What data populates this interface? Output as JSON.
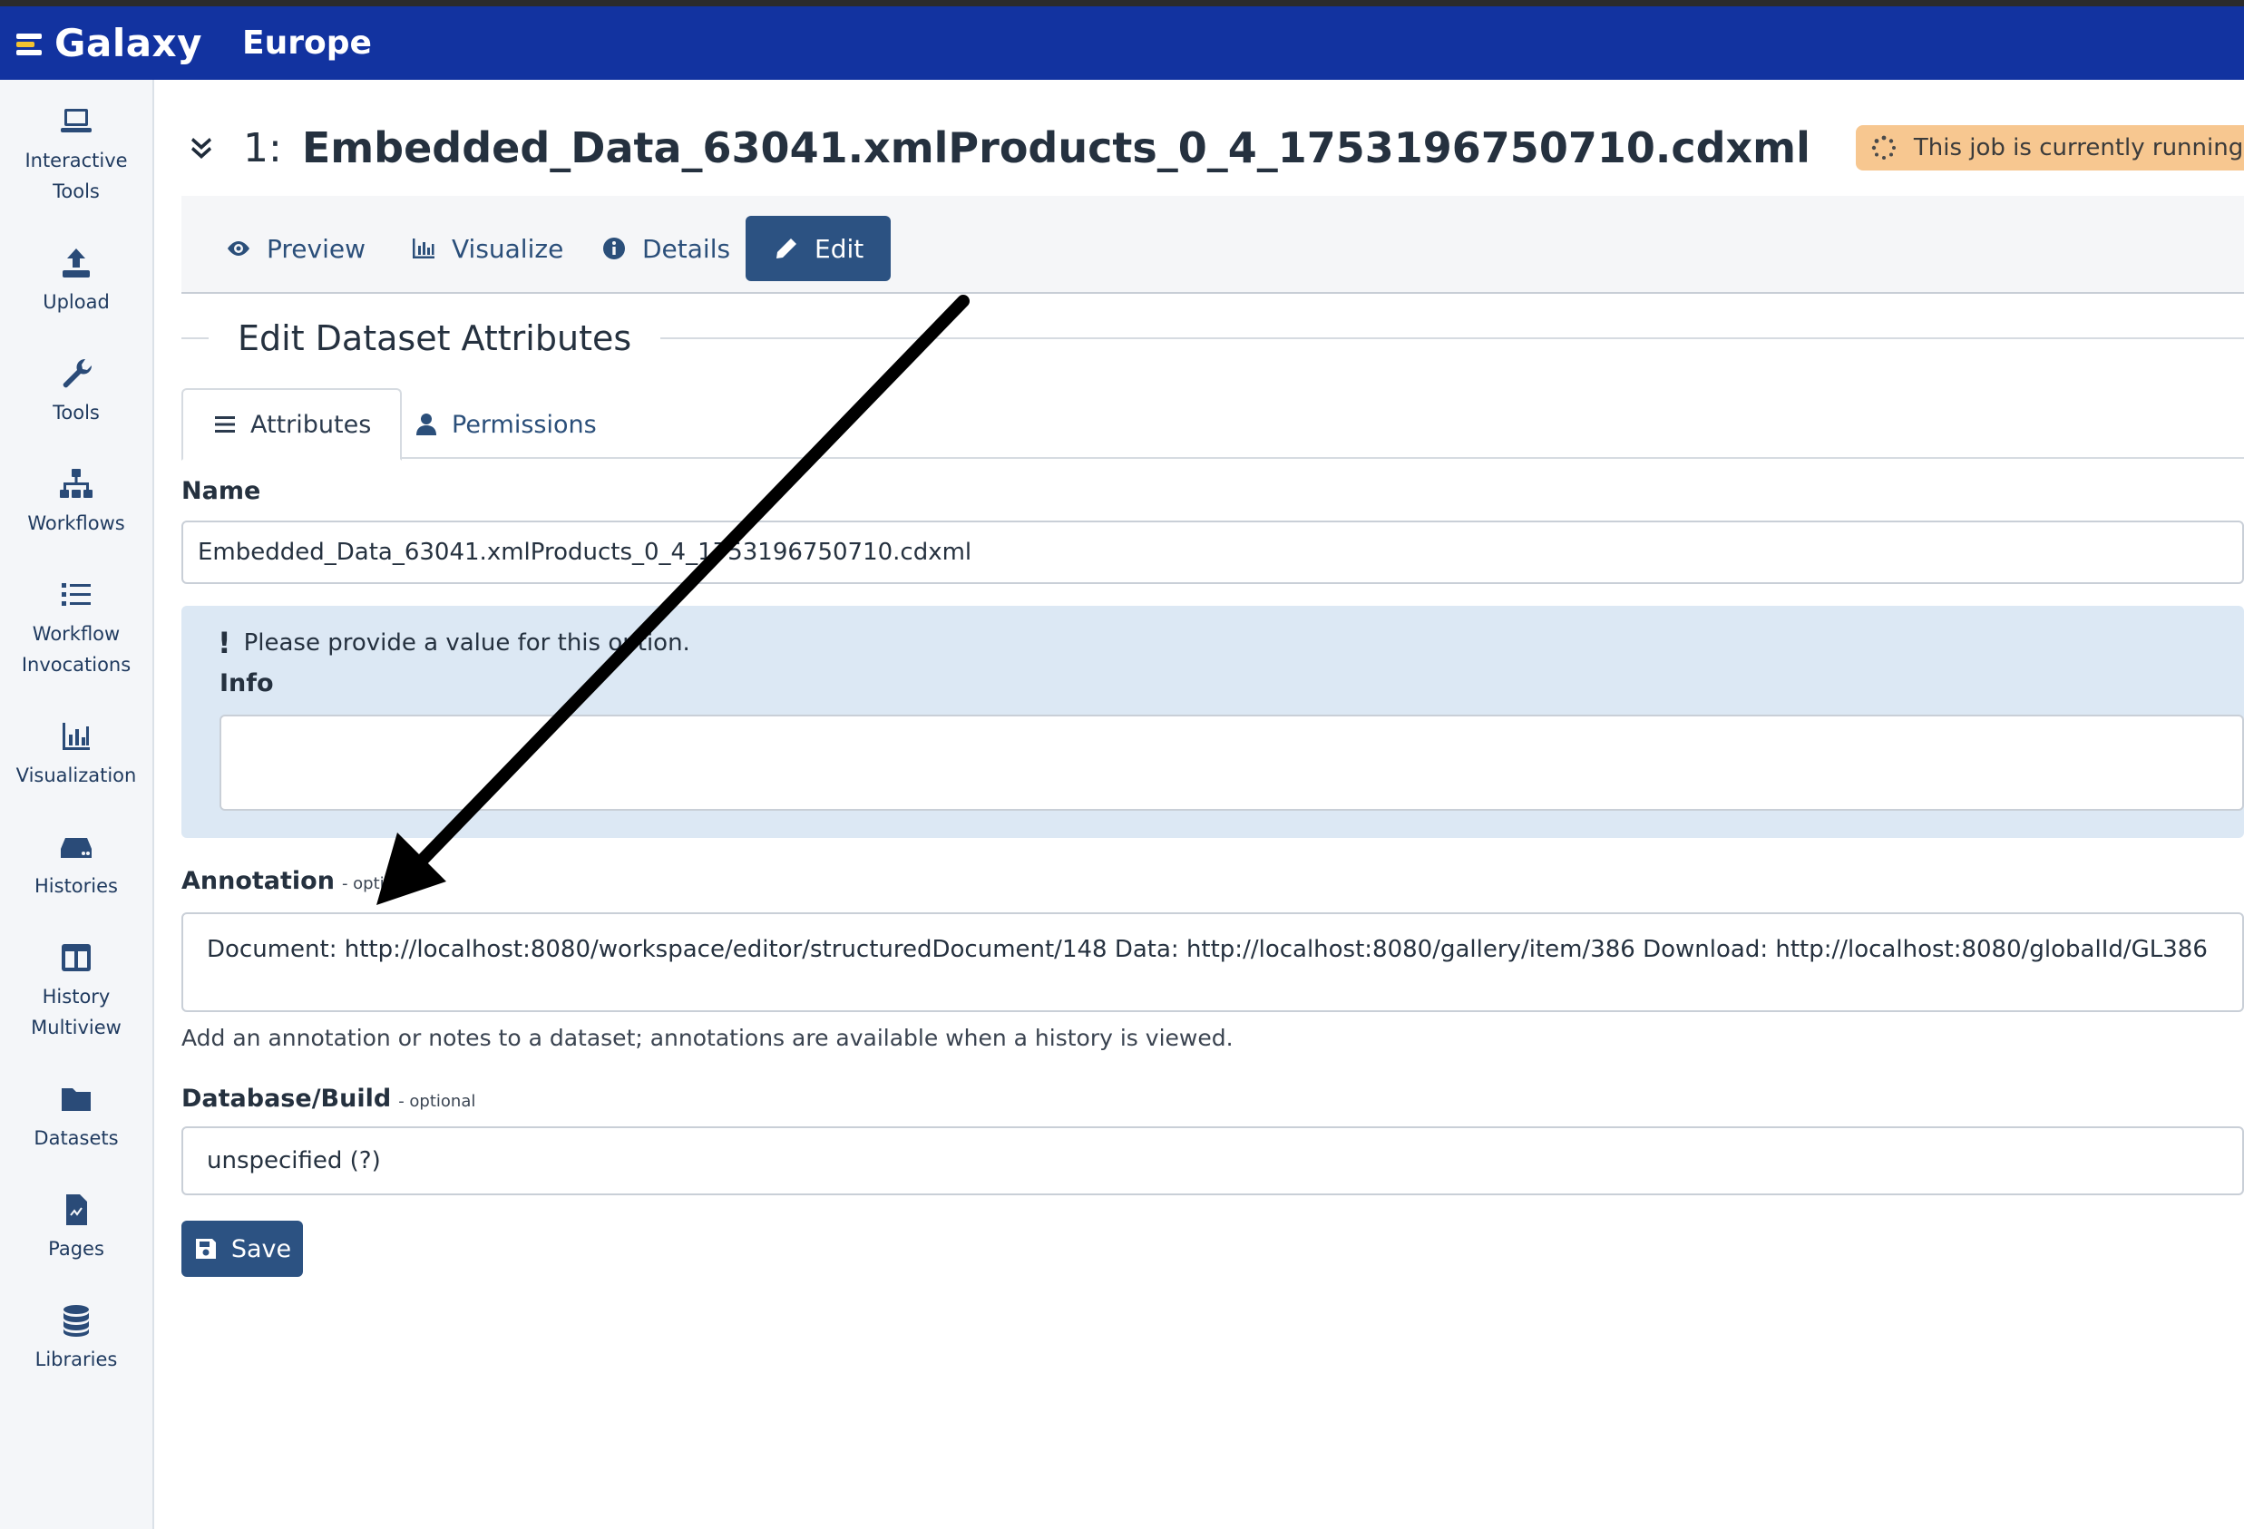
{
  "masthead": {
    "brand": "Galaxy",
    "subtitle": "Europe"
  },
  "sidebar": {
    "items": [
      {
        "label_line1": "Interactive",
        "label_line2": "Tools",
        "icon": "laptop-icon"
      },
      {
        "label_line1": "Upload",
        "label_line2": "",
        "icon": "upload-icon"
      },
      {
        "label_line1": "Tools",
        "label_line2": "",
        "icon": "wrench-icon"
      },
      {
        "label_line1": "Workflows",
        "label_line2": "",
        "icon": "sitemap-icon"
      },
      {
        "label_line1": "Workflow",
        "label_line2": "Invocations",
        "icon": "list-icon"
      },
      {
        "label_line1": "Visualization",
        "label_line2": "",
        "icon": "chart-icon"
      },
      {
        "label_line1": "Histories",
        "label_line2": "",
        "icon": "hdd-icon"
      },
      {
        "label_line1": "History",
        "label_line2": "Multiview",
        "icon": "columns-icon"
      },
      {
        "label_line1": "Datasets",
        "label_line2": "",
        "icon": "folder-icon"
      },
      {
        "label_line1": "Pages",
        "label_line2": "",
        "icon": "file-icon"
      },
      {
        "label_line1": "Libraries",
        "label_line2": "",
        "icon": "database-icon"
      }
    ]
  },
  "dataset": {
    "hid": "1:",
    "title": "Embedded_Data_63041.xmlProducts_0_4_1753196750710.cdxml",
    "state_text": "This job is currently running."
  },
  "tabs": {
    "preview": "Preview",
    "visualize": "Visualize",
    "details": "Details",
    "edit": "Edit"
  },
  "section": {
    "title": "Edit Dataset Attributes"
  },
  "subtabs": {
    "attributes": "Attributes",
    "permissions": "Permissions"
  },
  "form": {
    "name_label": "Name",
    "name_value": "Embedded_Data_63041.xmlProducts_0_4_1753196750710.cdxml",
    "alert_message": "Please provide a value for this option.",
    "alert_excl": "!",
    "info_label": "Info",
    "info_value": "",
    "annotation_label": "Annotation",
    "annotation_optional": "- optional",
    "annotation_value": "Document: http://localhost:8080/workspace/editor/structuredDocument/148 Data: http://localhost:8080/gallery/item/386 Download: http://localhost:8080/globalId/GL386",
    "annotation_help": "Add an annotation or notes to a dataset; annotations are available when a history is viewed.",
    "dbkey_label": "Database/Build",
    "dbkey_optional": "- optional",
    "dbkey_value": "unspecified (?)",
    "save_label": "Save"
  },
  "colors": {
    "masthead": "#1233a0",
    "primary": "#2c5282",
    "alert_bg": "#dce8f4",
    "running_badge": "#f7c790"
  }
}
